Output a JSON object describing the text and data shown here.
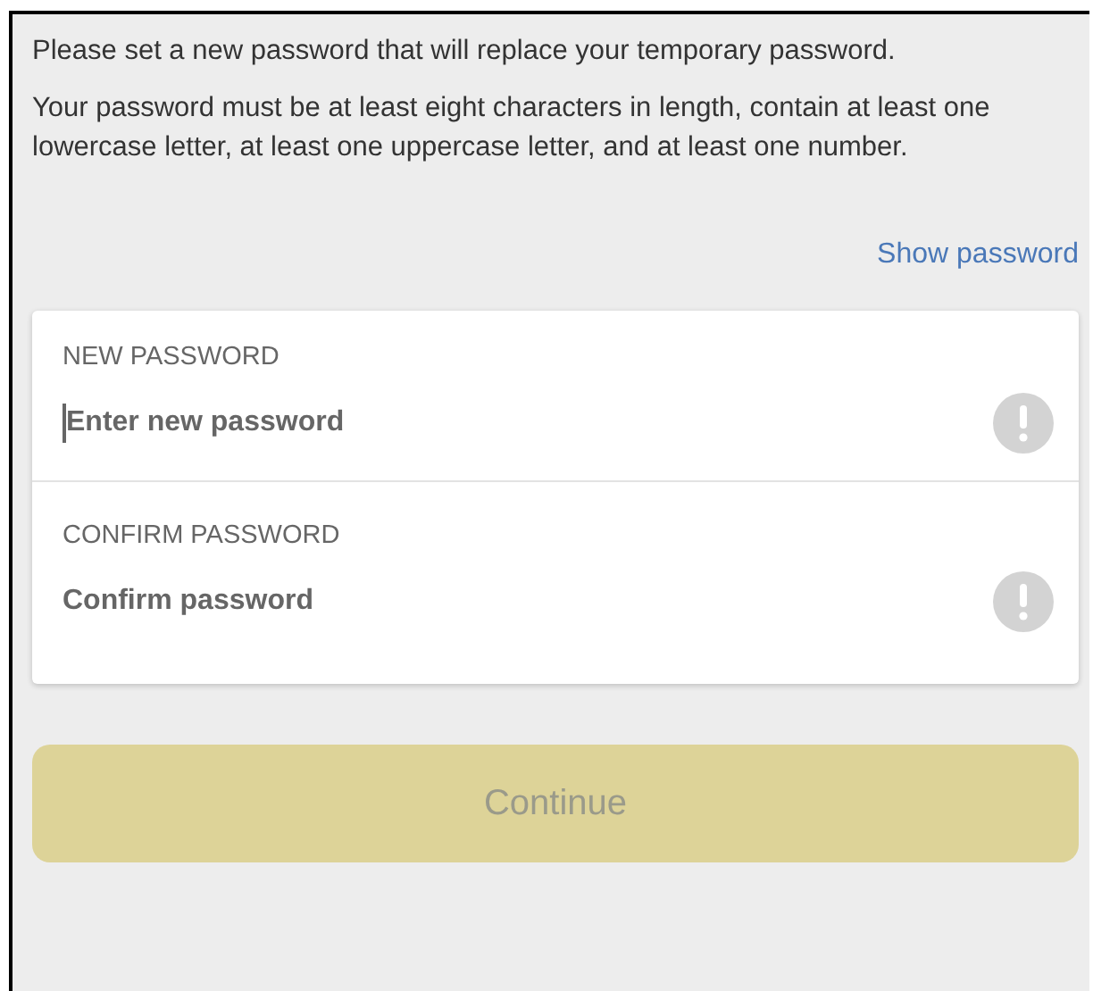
{
  "intro": "Please set a new password that will replace your temporary password.",
  "requirements": "Your password must be at least eight characters in length, contain at least one lowercase letter, at least one uppercase letter, and at least one number.",
  "show_password": {
    "label": "Show password"
  },
  "fields": [
    {
      "label": "NEW PASSWORD",
      "placeholder": "Enter new password",
      "focused": true
    },
    {
      "label": "CONFIRM PASSWORD",
      "placeholder": "Confirm password",
      "focused": false
    }
  ],
  "continue_button": {
    "label": "Continue",
    "disabled": true
  }
}
